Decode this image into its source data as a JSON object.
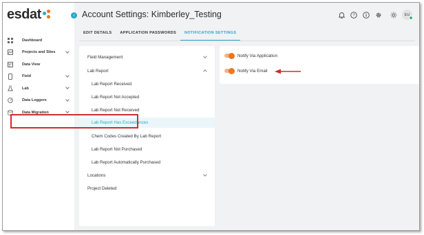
{
  "brand": {
    "logo_text": "esdat",
    "dot_colors": [
      "#2aa6c9",
      "#e87722",
      "#e87722"
    ]
  },
  "sidebar": {
    "items": [
      {
        "label": "Dashboard",
        "icon": "dashboard-grid-icon",
        "has_chevron": false
      },
      {
        "label": "Projects and Sites",
        "icon": "map-icon",
        "has_chevron": true
      },
      {
        "label": "Data View",
        "icon": "table-icon",
        "has_chevron": false
      },
      {
        "label": "Field",
        "icon": "mobile-device-icon",
        "has_chevron": true
      },
      {
        "label": "Lab",
        "icon": "flask-icon",
        "has_chevron": true
      },
      {
        "label": "Data Loggers",
        "icon": "gauge-icon",
        "has_chevron": true
      },
      {
        "label": "Data Migration",
        "icon": "database-icon",
        "has_chevron": true
      }
    ]
  },
  "header": {
    "title": "Account Settings: Kimberley_Testing",
    "icons": [
      "bell-icon",
      "help-icon",
      "info-icon",
      "settings-icon",
      "theme-sun-icon"
    ],
    "avatar_initials": "EU"
  },
  "tabs": [
    {
      "label": "EDIT DETAILS",
      "active": false
    },
    {
      "label": "APPLICATION PASSWORDS",
      "active": false
    },
    {
      "label": "NOTIFICATION SETTINGS",
      "active": true
    }
  ],
  "left_menu": {
    "field_management": "Field Management",
    "lab_report": "Lab Report",
    "sub_items": [
      "Lab Report Received",
      "Lab Report Not Accepted",
      "Lab Report Not Received",
      "Lab Report Has Exceedances",
      "Chem Codes Created By Lab Report",
      "Lab Report Not Purchased",
      "Lab Report Automatically Purchased"
    ],
    "selected_index": 3,
    "locations": "Locations",
    "project_deleted": "Project Deleted"
  },
  "notifications": {
    "via_application": {
      "label": "Notify Via Application",
      "enabled": true
    },
    "via_email": {
      "label": "Notify Via Email",
      "enabled": true
    }
  },
  "colors": {
    "accent": "#2aa6c9",
    "toggle_on": "#e87722",
    "annotation_red": "#d22a2a"
  }
}
